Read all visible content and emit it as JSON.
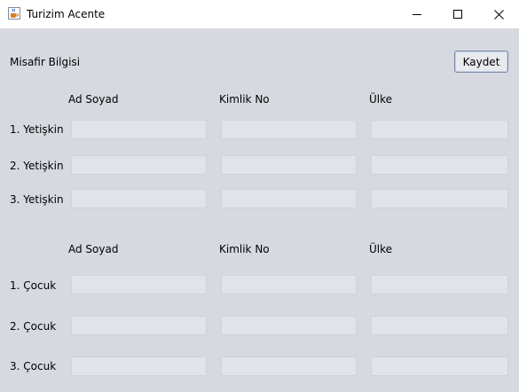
{
  "window": {
    "title": "Turizim Acente",
    "icon": "java-cup-icon"
  },
  "header": {
    "section_label": "Misafir Bilgisi",
    "save_label": "Kaydet"
  },
  "adults": {
    "columns": [
      "Ad Soyad",
      "Kimlik No",
      "Ülke"
    ],
    "rows": [
      {
        "label": "1. Yetişkin",
        "name": "",
        "id_no": "",
        "country": ""
      },
      {
        "label": "2. Yetişkin",
        "name": "",
        "id_no": "",
        "country": ""
      },
      {
        "label": "3. Yetişkin",
        "name": "",
        "id_no": "",
        "country": ""
      }
    ]
  },
  "children": {
    "columns": [
      "Ad Soyad",
      "Kimlik No",
      "Ülke"
    ],
    "rows": [
      {
        "label": "1. Çocuk",
        "name": "",
        "id_no": "",
        "country": ""
      },
      {
        "label": "2. Çocuk",
        "name": "",
        "id_no": "",
        "country": ""
      },
      {
        "label": "3. Çocuk",
        "name": "",
        "id_no": "",
        "country": ""
      }
    ]
  }
}
